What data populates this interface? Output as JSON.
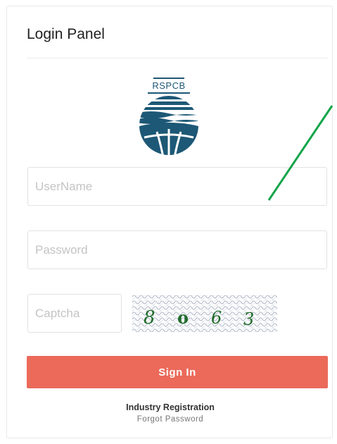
{
  "panel": {
    "title": "Login Panel"
  },
  "logo": {
    "text": "RSPCB",
    "icon": "rspcb-globe-logo",
    "color": "#1d5876"
  },
  "form": {
    "username_placeholder": "UserName",
    "password_placeholder": "Password",
    "captcha_placeholder": "Captcha",
    "captcha_chars": [
      "8",
      "o",
      "6",
      "3"
    ],
    "signin_label": "Sign In"
  },
  "links": {
    "registration": "Industry Registration",
    "forgot_password": "Forgot Password"
  },
  "colors": {
    "accent": "#eb6a5a",
    "captcha_text": "#1e6b2a",
    "annotation_line": "#12a44a"
  }
}
